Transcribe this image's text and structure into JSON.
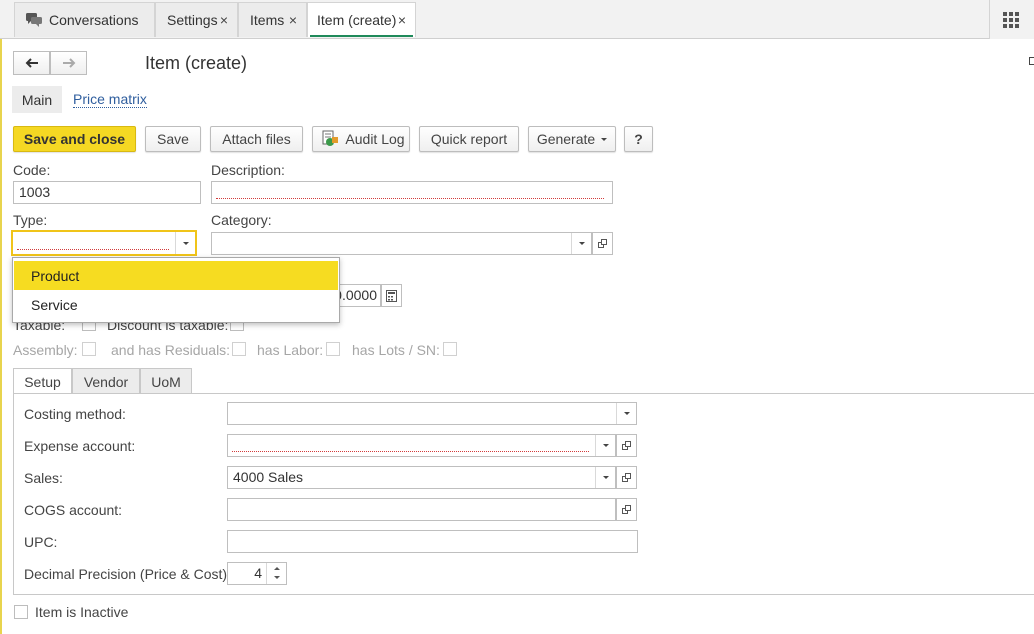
{
  "tabs": [
    {
      "label": "Conversations",
      "icon": "chat-bubbles-icon",
      "closable": false,
      "active": false
    },
    {
      "label": "Settings",
      "closable": true,
      "active": false
    },
    {
      "label": "Items",
      "closable": true,
      "active": false
    },
    {
      "label": "Item (create)",
      "closable": true,
      "active": true
    }
  ],
  "tab_close_glyph": "×",
  "page": {
    "title": "Item (create)",
    "subnav": {
      "main": "Main",
      "price_matrix": "Price matrix"
    }
  },
  "toolbar": {
    "save_close": "Save and close",
    "save": "Save",
    "attach": "Attach files",
    "audit": "Audit Log",
    "quick_report": "Quick report",
    "generate": "Generate",
    "help": "?"
  },
  "form": {
    "code_label": "Code:",
    "code_value": "1003",
    "description_label": "Description:",
    "description_value": "",
    "type_label": "Type:",
    "type_value": "",
    "category_label": "Category:",
    "category_value": "",
    "price_value": "0.0000",
    "taxable_label": "Taxable:",
    "discount_taxable_label": "Discount is taxable:",
    "assembly_label": "Assembly:",
    "has_residuals_label": "and has Residuals:",
    "has_labor_label": "has Labor:",
    "has_lots_label": "has Lots / SN:"
  },
  "type_options": {
    "selected": "Product",
    "items": [
      "Product",
      "Service"
    ]
  },
  "form_tabs": {
    "setup": "Setup",
    "vendor": "Vendor",
    "uom": "UoM"
  },
  "setup": {
    "costing_label": "Costing method:",
    "costing_value": "",
    "expense_label": "Expense account:",
    "expense_value": "",
    "sales_label": "Sales:",
    "sales_value": "4000 Sales",
    "cogs_label": "COGS account:",
    "cogs_value": "",
    "upc_label": "UPC:",
    "upc_value": "",
    "precision_label": "Decimal Precision (Price & Cost):",
    "precision_value": "4"
  },
  "inactive_label": "Item is Inactive",
  "colors": {
    "accent": "#f5d823",
    "tab_underline": "#1f8a5a",
    "required": "#d23b3b"
  }
}
